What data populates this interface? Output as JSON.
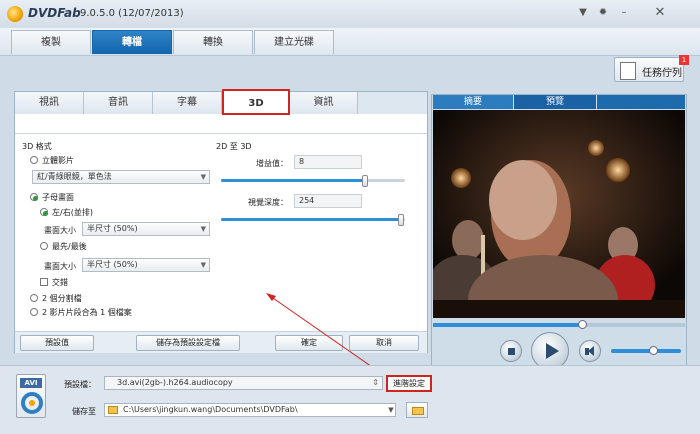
{
  "titlebar": {
    "app_name": "DVDFab",
    "version": "9.0.5.0 (12/07/2013)",
    "icons": [
      "down-arrow-icon",
      "gear-icon",
      "minimize-icon",
      "close-icon"
    ]
  },
  "nav": {
    "tabs": [
      "複製",
      "轉檔",
      "轉換",
      "建立光碟"
    ],
    "active": "轉檔"
  },
  "queue": {
    "label": "任務佇列",
    "badge": "1"
  },
  "subtabs": {
    "items": [
      "視訊",
      "音訊",
      "字幕",
      "3D",
      "資訊"
    ],
    "active": "3D"
  },
  "format3d": {
    "heading": "3D 格式",
    "anaglyph_label": "立體影片",
    "anaglyph_dropdown": "紅/青綠眼鏡，單色法",
    "sbs_label": "子母畫面",
    "lr_label": "左/右(並排)",
    "size_label_1": "畫面大小",
    "size_value_1": "半尺寸 (50%)",
    "tb_label": "最先/最後",
    "size_label_2": "畫面大小",
    "size_value_2": "半尺寸 (50%)",
    "interleave_label": "交錯",
    "split_label": "2 個分割檔",
    "merge_label": "2 影片片段合為 1 個檔案"
  },
  "conv2d3d": {
    "heading": "2D 至 3D",
    "gain_label": "增益值：",
    "gain_value": "8",
    "gain_fraction": 0.78,
    "depth_label": "視覺深度：",
    "depth_value": "254",
    "depth_fraction": 0.98
  },
  "panel_buttons": {
    "default": "預設值",
    "save_profile": "儲存為預設設定檔",
    "ok": "確定",
    "cancel": "取消"
  },
  "preview": {
    "tabs": [
      "摘要",
      "預覽"
    ],
    "active": "預覽",
    "seek_fraction": 0.59,
    "volume_fraction": 0.6
  },
  "bottom": {
    "file_type": "AVI",
    "profile_label": "預設檔：",
    "profile_value": "3d.avi(2gb-).h264.audiocopy",
    "advanced_label": "進階設定",
    "saveto_label": "儲存至",
    "saveto_value": "C:\\Users\\jingkun.wang\\Documents\\DVDFab\\"
  },
  "colors": {
    "accent": "#1366ad",
    "highlight": "#d0241f",
    "active_radio": "#2b9a3d"
  }
}
